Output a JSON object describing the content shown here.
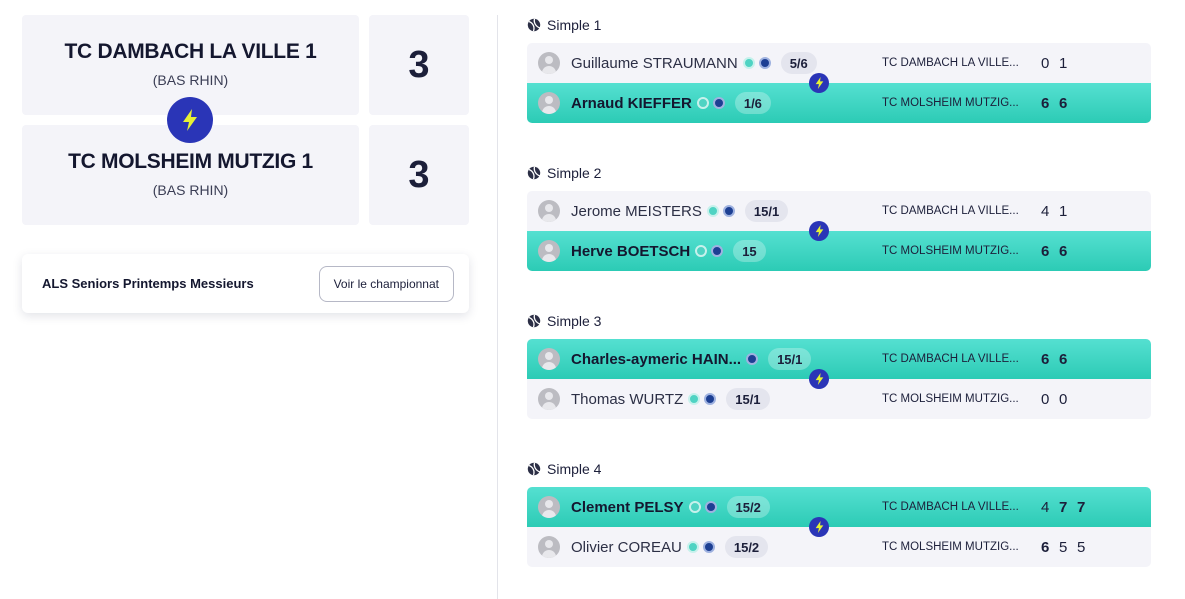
{
  "teams": [
    {
      "name": "TC DAMBACH LA VILLE 1",
      "region": "(BAS RHIN)",
      "score": "3"
    },
    {
      "name": "TC MOLSHEIM MUTZIG 1",
      "region": "(BAS RHIN)",
      "score": "3"
    }
  ],
  "championship": {
    "title": "ALS Seniors Printemps Messieurs",
    "button_label": "Voir le championnat"
  },
  "colors": {
    "accent": "#2a35b7",
    "winner_bg": "#3dd6c3",
    "row_bg": "#f4f4f9",
    "bolt": "#e7f234"
  },
  "matches": [
    {
      "title": "Simple 1",
      "rows": [
        {
          "player": "Guillaume STRAUMANN",
          "rank": "5/6",
          "club": "TC DAMBACH LA VILLE...",
          "sets": [
            "0",
            "1"
          ],
          "winner": false
        },
        {
          "player": "Arnaud KIEFFER",
          "rank": "1/6",
          "club": "TC MOLSHEIM MUTZIG...",
          "sets": [
            "6",
            "6"
          ],
          "winner": true
        }
      ]
    },
    {
      "title": "Simple 2",
      "rows": [
        {
          "player": "Jerome MEISTERS",
          "rank": "15/1",
          "club": "TC DAMBACH LA VILLE...",
          "sets": [
            "4",
            "1"
          ],
          "winner": false
        },
        {
          "player": "Herve BOETSCH",
          "rank": "15",
          "club": "TC MOLSHEIM MUTZIG...",
          "sets": [
            "6",
            "6"
          ],
          "winner": true
        }
      ]
    },
    {
      "title": "Simple 3",
      "rows": [
        {
          "player": "Charles-aymeric HAIN...",
          "rank": "15/1",
          "club": "TC DAMBACH LA VILLE...",
          "sets": [
            "6",
            "6"
          ],
          "winner": true
        },
        {
          "player": "Thomas WURTZ",
          "rank": "15/1",
          "club": "TC MOLSHEIM MUTZIG...",
          "sets": [
            "0",
            "0"
          ],
          "winner": false
        }
      ]
    },
    {
      "title": "Simple 4",
      "rows": [
        {
          "player": "Clement PELSY",
          "rank": "15/2",
          "club": "TC DAMBACH LA VILLE...",
          "sets": [
            "4",
            "7",
            "7"
          ],
          "winner": true
        },
        {
          "player": "Olivier COREAU",
          "rank": "15/2",
          "club": "TC MOLSHEIM MUTZIG...",
          "sets": [
            "6",
            "5",
            "5"
          ],
          "winner": false
        }
      ]
    }
  ]
}
